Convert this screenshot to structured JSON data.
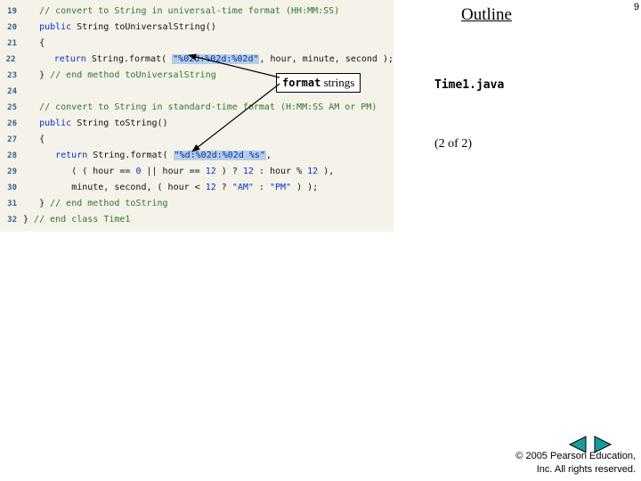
{
  "slide": {
    "outline": "Outline",
    "page_number": "9",
    "filename": "Time1.java",
    "page_count": "(2 of 2)",
    "callout_bold": "format",
    "callout_rest": " strings",
    "copyright_line1": "© 2005 Pearson Education,",
    "copyright_line2": "Inc.  All rights reserved."
  },
  "code": {
    "l19": {
      "n": "19",
      "cmt": "// convert to String in universal-time format (HH:MM:SS)"
    },
    "l20": {
      "n": "20",
      "kw": "public",
      "rest": " String toUniversalString()"
    },
    "l21": {
      "n": "21",
      "brace": "{"
    },
    "l22": {
      "n": "22",
      "kw": "return",
      "pre": " String.format( ",
      "str": "\"%02d:%02d:%02d\"",
      "post": ", hour, minute, second );"
    },
    "l23": {
      "n": "23",
      "brace": "} ",
      "cmt": "// end method toUniversalString"
    },
    "l24": {
      "n": "24"
    },
    "l25": {
      "n": "25",
      "cmt": "// convert to String in standard-time format (H:MM:SS AM or PM)"
    },
    "l26": {
      "n": "26",
      "kw": "public",
      "rest": " String toString()"
    },
    "l27": {
      "n": "27",
      "brace": "{"
    },
    "l28": {
      "n": "28",
      "kw": "return",
      "pre": " String.format( ",
      "str": "\"%d:%02d:%02d %s\"",
      "post": ","
    },
    "l29": {
      "n": "29",
      "a": "( ( hour == ",
      "b": "0",
      "c": " || hour == ",
      "d": "12",
      "e": " ) ? ",
      "f": "12",
      "g": " : hour % ",
      "h": "12",
      "i": " ),"
    },
    "l30": {
      "n": "30",
      "a": "minute, second, ( hour < ",
      "b": "12",
      "c": " ? ",
      "d": "\"AM\"",
      "e": " : ",
      "f": "\"PM\"",
      "g": " ) );"
    },
    "l31": {
      "n": "31",
      "brace": "} ",
      "cmt": "// end method toString"
    },
    "l32": {
      "n": "32",
      "brace": "} ",
      "cmt": "// end class Time1"
    }
  }
}
